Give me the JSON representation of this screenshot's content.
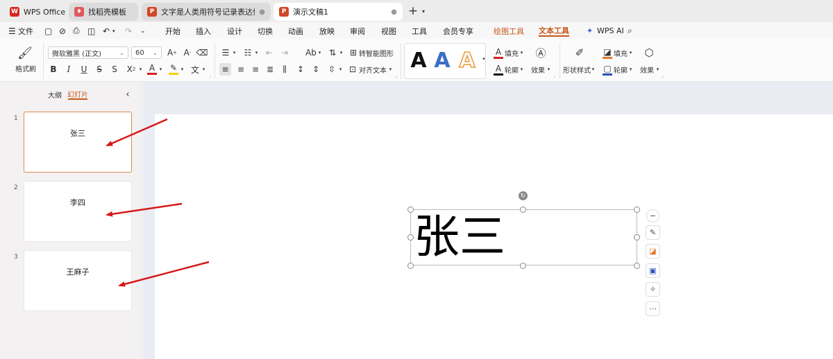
{
  "tabs": [
    {
      "label": "WPS Office",
      "icon": "wps-logo-icon",
      "color": "#d7261e"
    },
    {
      "label": "找稻壳模板",
      "icon": "docer-icon",
      "color": "#e05a5a"
    },
    {
      "label": "文字是人类用符号记录表达信息以",
      "icon": "ppt-icon",
      "color": "#d24726"
    },
    {
      "label": "演示文稿1",
      "icon": "ppt-icon",
      "color": "#d24726"
    }
  ],
  "menu": {
    "file": "文件",
    "items": [
      "开始",
      "插入",
      "设计",
      "切换",
      "动画",
      "放映",
      "审阅",
      "视图",
      "工具",
      "会员专享"
    ],
    "drawing_tools": "绘图工具",
    "text_tools": "文本工具",
    "wps_ai": "WPS AI"
  },
  "ribbon": {
    "format_painter": "格式刷",
    "font_name": "微软雅黑 (正文)",
    "font_size": "60",
    "smart_graphic": "转智能图形",
    "align_text": "对齐文本",
    "text_fill": "填充",
    "text_outline": "轮廓",
    "text_effect": "效果",
    "shape_style": "形状样式",
    "shape_fill": "填充",
    "shape_outline": "轮廓",
    "shape_effect": "效果",
    "style_glyphs": [
      "A",
      "A",
      "A"
    ],
    "style_colors": [
      "#111111",
      "#3a6fc4",
      "#e89a3c"
    ],
    "accent": "#c7581b"
  },
  "pane": {
    "tab_outline": "大纲",
    "tab_slides": "幻灯片",
    "slides": [
      {
        "number": "1",
        "title": "张三"
      },
      {
        "number": "2",
        "title": "李四"
      },
      {
        "number": "3",
        "title": "王麻子"
      }
    ]
  },
  "slide": {
    "text": "张三"
  },
  "float_toolbar": [
    "collapse-icon",
    "pen-icon",
    "fill-icon",
    "outline-icon",
    "magic-icon",
    "more-icon"
  ]
}
